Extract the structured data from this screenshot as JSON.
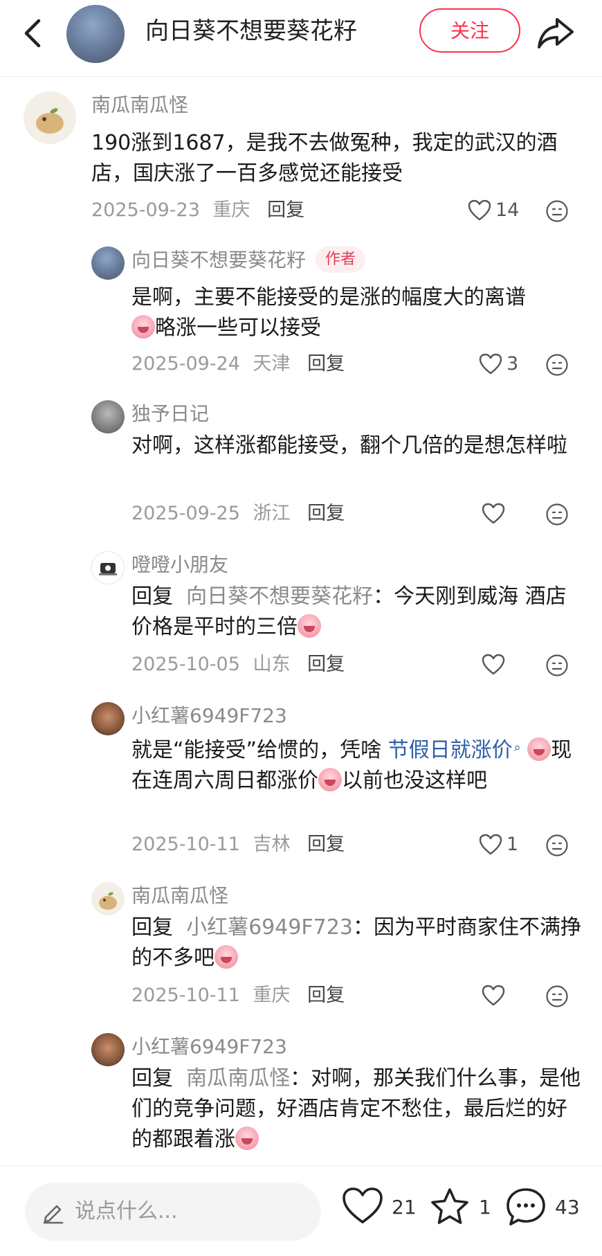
{
  "header": {
    "title": "向日葵不想要葵花籽",
    "follow_label": "关注"
  },
  "comments": [
    {
      "user": "南瓜南瓜怪",
      "text": "190涨到1687，是我不去做冤种，我定的武汉的酒店，国庆涨了一百多感觉还能接受",
      "date": "2025-09-23",
      "location": "重庆",
      "reply_label": "回复",
      "likes": "14"
    },
    {
      "user": "向日葵不想要葵花籽",
      "badge": "作者",
      "text_1": "是啊，主要不能接受的是涨的幅度大的离谱",
      "text_2": "略涨一些可以接受",
      "date": "2025-09-24",
      "location": "天津",
      "reply_label": "回复",
      "likes": "3"
    },
    {
      "user": "独予日记",
      "text": "对啊，这样涨都能接受，翻个几倍的是想怎样啦",
      "date": "2025-09-25",
      "location": "浙江",
      "reply_label": "回复",
      "likes": ""
    },
    {
      "user": "噔噔小朋友",
      "reply_prefix": "回复",
      "reply_target": "向日葵不想要葵花籽",
      "text": "：今天刚到威海 酒店价格是平时的三倍",
      "date": "2025-10-05",
      "location": "山东",
      "reply_label": "回复",
      "likes": ""
    },
    {
      "user": "小红薯6949F723",
      "text_1": "就是“能接受”给惯的，凭啥",
      "topic": "节假日就涨价",
      "text_2": "现在连周六周日都涨价",
      "text_3": "以前也没这样吧",
      "date": "2025-10-11",
      "location": "吉林",
      "reply_label": "回复",
      "likes": "1"
    },
    {
      "user": "南瓜南瓜怪",
      "reply_prefix": "回复",
      "reply_target": "小红薯6949F723",
      "text": "：因为平时商家住不满挣的不多吧",
      "date": "2025-10-11",
      "location": "重庆",
      "reply_label": "回复",
      "likes": ""
    },
    {
      "user": "小红薯6949F723",
      "reply_prefix": "回复",
      "reply_target": "南瓜南瓜怪",
      "text": "：对啊，那关我们什么事，是他们的竞争问题，好酒店肯定不愁住，最后烂的好的都跟着涨"
    }
  ],
  "bottom_bar": {
    "input_placeholder": "说点什么...",
    "likes": "21",
    "stars": "1",
    "comments": "43"
  },
  "colors": {
    "accent": "#ff2f4c",
    "topic_link": "#2e5da8",
    "badge_bg": "#fdeef0"
  }
}
